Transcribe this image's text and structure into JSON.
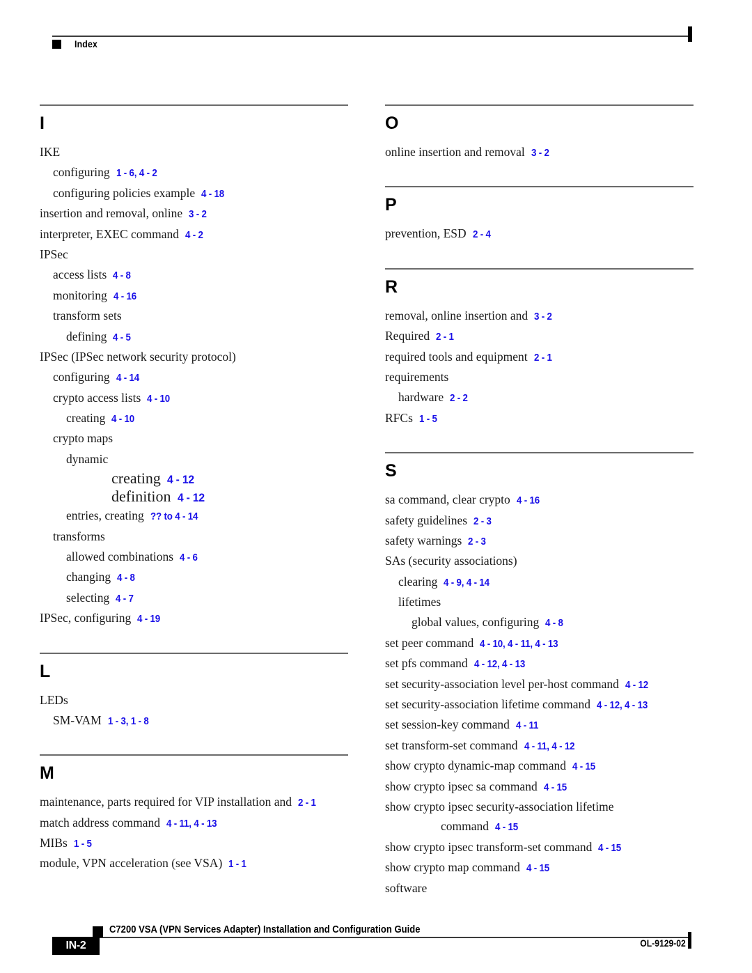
{
  "header": {
    "label": "Index",
    "marker_icon": "black-square-icon"
  },
  "columns": {
    "left": [
      {
        "letter": "I",
        "entries": [
          {
            "level": 0,
            "text": "IKE",
            "ref": ""
          },
          {
            "level": 1,
            "text": "configuring",
            "ref": "1 - 6, 4 - 2"
          },
          {
            "level": 1,
            "text": "configuring policies example",
            "ref": "4 - 18"
          },
          {
            "level": 0,
            "text": "insertion and removal, online",
            "ref": "3 - 2"
          },
          {
            "level": 0,
            "text": "interpreter, EXEC command",
            "ref": "4 - 2"
          },
          {
            "level": 0,
            "text": "IPSec",
            "ref": ""
          },
          {
            "level": 1,
            "text": "access lists",
            "ref": "4 - 8"
          },
          {
            "level": 1,
            "text": "monitoring",
            "ref": "4 - 16"
          },
          {
            "level": 1,
            "text": "transform sets",
            "ref": ""
          },
          {
            "level": 2,
            "text": "defining",
            "ref": "4 - 5"
          },
          {
            "level": 0,
            "text": "IPSec (IPSec network security protocol)",
            "ref": ""
          },
          {
            "level": 1,
            "text": "configuring",
            "ref": "4 - 14"
          },
          {
            "level": 1,
            "text": "crypto access lists",
            "ref": "4 - 10"
          },
          {
            "level": 2,
            "text": "creating",
            "ref": "4 - 10"
          },
          {
            "level": 1,
            "text": "crypto maps",
            "ref": ""
          },
          {
            "level": 2,
            "text": "dynamic",
            "ref": ""
          },
          {
            "level": "odd",
            "text": "creating",
            "ref": "4 - 12"
          },
          {
            "level": "odd",
            "text": "definition",
            "ref": "4 - 12"
          },
          {
            "level": 2,
            "text": "entries, creating",
            "ref": "?? to 4 - 14"
          },
          {
            "level": 1,
            "text": "transforms",
            "ref": ""
          },
          {
            "level": 2,
            "text": "allowed combinations",
            "ref": "4 - 6"
          },
          {
            "level": 2,
            "text": "changing",
            "ref": "4 - 8"
          },
          {
            "level": 2,
            "text": "selecting",
            "ref": "4 - 7"
          },
          {
            "level": 0,
            "text": "IPSec, configuring",
            "ref": "4 - 19"
          }
        ]
      },
      {
        "letter": "L",
        "entries": [
          {
            "level": 0,
            "text": "LEDs",
            "ref": ""
          },
          {
            "level": 1,
            "text": "SM-VAM",
            "ref": "1 - 3, 1 - 8"
          }
        ]
      },
      {
        "letter": "M",
        "entries": [
          {
            "level": 0,
            "text": "maintenance, parts required for VIP installation and",
            "ref": "2 - 1"
          },
          {
            "level": 0,
            "text": "match address command",
            "ref": "4 - 11, 4 - 13"
          },
          {
            "level": 0,
            "text": "MIBs",
            "ref": "1 - 5"
          },
          {
            "level": 0,
            "text": "module, VPN acceleration (see VSA)",
            "ref": "1 - 1"
          }
        ]
      }
    ],
    "right": [
      {
        "letter": "O",
        "entries": [
          {
            "level": 0,
            "text": "online insertion and removal",
            "ref": "3 - 2"
          }
        ]
      },
      {
        "letter": "P",
        "entries": [
          {
            "level": 0,
            "text": "prevention, ESD",
            "ref": "2 - 4"
          }
        ]
      },
      {
        "letter": "R",
        "entries": [
          {
            "level": 0,
            "text": "removal, online insertion and",
            "ref": "3 - 2"
          },
          {
            "level": 0,
            "text": "Required",
            "ref": "2 - 1"
          },
          {
            "level": 0,
            "text": "required tools and equipment",
            "ref": "2 - 1"
          },
          {
            "level": 0,
            "text": "requirements",
            "ref": ""
          },
          {
            "level": 1,
            "text": "hardware",
            "ref": "2 - 2"
          },
          {
            "level": 0,
            "text": "RFCs",
            "ref": "1 - 5"
          }
        ]
      },
      {
        "letter": "S",
        "entries": [
          {
            "level": 0,
            "text": "sa command, clear crypto",
            "ref": "4 - 16"
          },
          {
            "level": 0,
            "text": "safety guidelines",
            "ref": "2 - 3"
          },
          {
            "level": 0,
            "text": "safety warnings",
            "ref": "2 - 3"
          },
          {
            "level": 0,
            "text": "SAs (security associations)",
            "ref": ""
          },
          {
            "level": 1,
            "text": "clearing",
            "ref": "4 - 9, 4 - 14"
          },
          {
            "level": 1,
            "text": "lifetimes",
            "ref": ""
          },
          {
            "level": 2,
            "text": "global values, configuring",
            "ref": "4 - 8"
          },
          {
            "level": 0,
            "text": "set peer command",
            "ref": "4 - 10, 4 - 11, 4 - 13"
          },
          {
            "level": 0,
            "text": "set pfs command",
            "ref": "4 - 12, 4 - 13"
          },
          {
            "level": 0,
            "text": "set security-association level per-host command",
            "ref": "4 - 12"
          },
          {
            "level": 0,
            "text": "set security-association lifetime command",
            "ref": "4 - 12, 4 - 13"
          },
          {
            "level": 0,
            "text": "set session-key command",
            "ref": "4 - 11"
          },
          {
            "level": 0,
            "text": "set transform-set command",
            "ref": "4 - 11, 4 - 12"
          },
          {
            "level": 0,
            "text": "show crypto dynamic-map command",
            "ref": "4 - 15"
          },
          {
            "level": 0,
            "text": "show crypto ipsec sa command",
            "ref": "4 - 15"
          },
          {
            "level": 0,
            "text": "show crypto ipsec security-association lifetime",
            "ref": "",
            "continuation": "command",
            "continuation_ref": "4 - 15"
          },
          {
            "level": 0,
            "text": "show crypto ipsec transform-set command",
            "ref": "4 - 15"
          },
          {
            "level": 0,
            "text": "show crypto map command",
            "ref": "4 - 15"
          },
          {
            "level": 0,
            "text": "software",
            "ref": ""
          }
        ]
      }
    ]
  },
  "footer": {
    "page_tab": "IN-2",
    "title": "C7200 VSA (VPN Services Adapter) Installation and Configuration Guide",
    "doc_id": "OL-9129-02",
    "marker_icon": "black-square-icon"
  },
  "colors": {
    "reference_blue": "#1a10e8",
    "text_black": "#1a1a1a",
    "rule_gray": "#6b6b6b"
  }
}
